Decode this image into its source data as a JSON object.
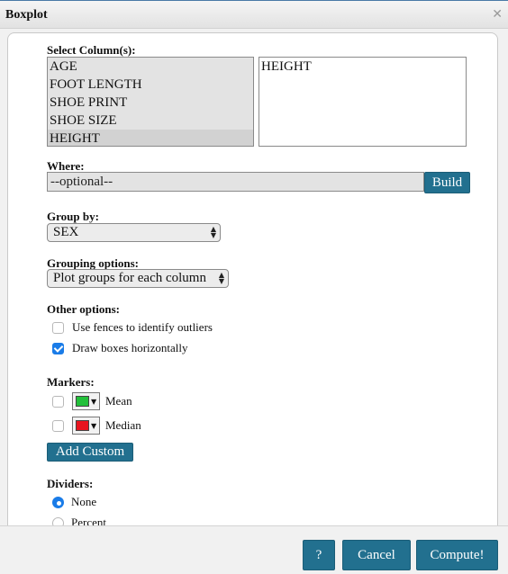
{
  "dialog": {
    "title": "Boxplot",
    "close_glyph": "✕"
  },
  "select_columns": {
    "label": "Select Column(s):",
    "available": [
      "AGE",
      "FOOT LENGTH",
      "SHOE PRINT",
      "SHOE SIZE",
      "HEIGHT"
    ],
    "selected_highlight": "HEIGHT",
    "chosen": [
      "HEIGHT"
    ]
  },
  "where": {
    "label": "Where:",
    "value": "--optional--",
    "build_label": "Build"
  },
  "group_by": {
    "label": "Group by:",
    "value": "SEX"
  },
  "grouping_options": {
    "label": "Grouping options:",
    "value": "Plot groups for each column"
  },
  "other_options": {
    "label": "Other options:",
    "fences": {
      "label": "Use fences to identify outliers",
      "checked": false
    },
    "horizontal": {
      "label": "Draw boxes horizontally",
      "checked": true
    }
  },
  "markers": {
    "label": "Markers:",
    "mean": {
      "label": "Mean",
      "color": "#22c03a"
    },
    "median": {
      "label": "Median",
      "color": "#e8141e"
    },
    "add_custom_label": "Add Custom"
  },
  "dividers": {
    "label": "Dividers:",
    "none_label": "None",
    "percent_label": "Percent"
  },
  "footer": {
    "help_label": "?",
    "cancel_label": "Cancel",
    "compute_label": "Compute!"
  },
  "colors": {
    "accent": "#22708f",
    "check": "#1a7ce8"
  }
}
